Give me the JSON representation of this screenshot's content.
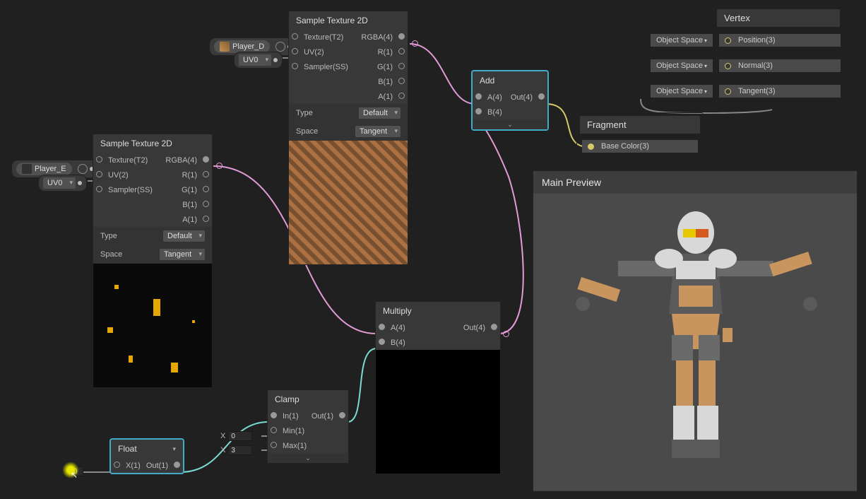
{
  "nodes": {
    "sample1": {
      "title": "Sample Texture 2D",
      "inputs": [
        "Texture(T2)",
        "UV(2)",
        "Sampler(SS)"
      ],
      "outputs": [
        "RGBA(4)",
        "R(1)",
        "G(1)",
        "B(1)",
        "A(1)"
      ],
      "typeLabel": "Type",
      "typeValue": "Default",
      "spaceLabel": "Space",
      "spaceValue": "Tangent"
    },
    "sample2": {
      "title": "Sample Texture 2D",
      "inputs": [
        "Texture(T2)",
        "UV(2)",
        "Sampler(SS)"
      ],
      "outputs": [
        "RGBA(4)",
        "R(1)",
        "G(1)",
        "B(1)",
        "A(1)"
      ],
      "typeLabel": "Type",
      "typeValue": "Default",
      "spaceLabel": "Space",
      "spaceValue": "Tangent"
    },
    "add": {
      "title": "Add",
      "inputs": [
        "A(4)",
        "B(4)"
      ],
      "outputs": [
        "Out(4)"
      ]
    },
    "multiply": {
      "title": "Multiply",
      "inputs": [
        "A(4)",
        "B(4)"
      ],
      "outputs": [
        "Out(4)"
      ]
    },
    "clamp": {
      "title": "Clamp",
      "inputs": [
        "In(1)",
        "Min(1)",
        "Max(1)"
      ],
      "outputs": [
        "Out(1)"
      ]
    },
    "float": {
      "title": "Float",
      "inputs": [
        "X(1)"
      ],
      "outputs": [
        "Out(1)"
      ]
    },
    "vertex": {
      "title": "Vertex",
      "rows": [
        "Position(3)",
        "Normal(3)",
        "Tangent(3)"
      ],
      "space": "Object Space"
    },
    "fragment": {
      "title": "Fragment",
      "rows": [
        "Base Color(3)"
      ]
    }
  },
  "props": {
    "playerD": "Player_D",
    "playerE": "Player_E",
    "uv0": "UV0"
  },
  "fields": {
    "min": "0",
    "max": "3",
    "floatX": "0"
  },
  "preview": {
    "title": "Main Preview"
  },
  "colors": {
    "pinkWire": "#e29ad6",
    "tealWire": "#7adad2",
    "yellowWire": "#d6c96a",
    "greyWire": "#888"
  }
}
